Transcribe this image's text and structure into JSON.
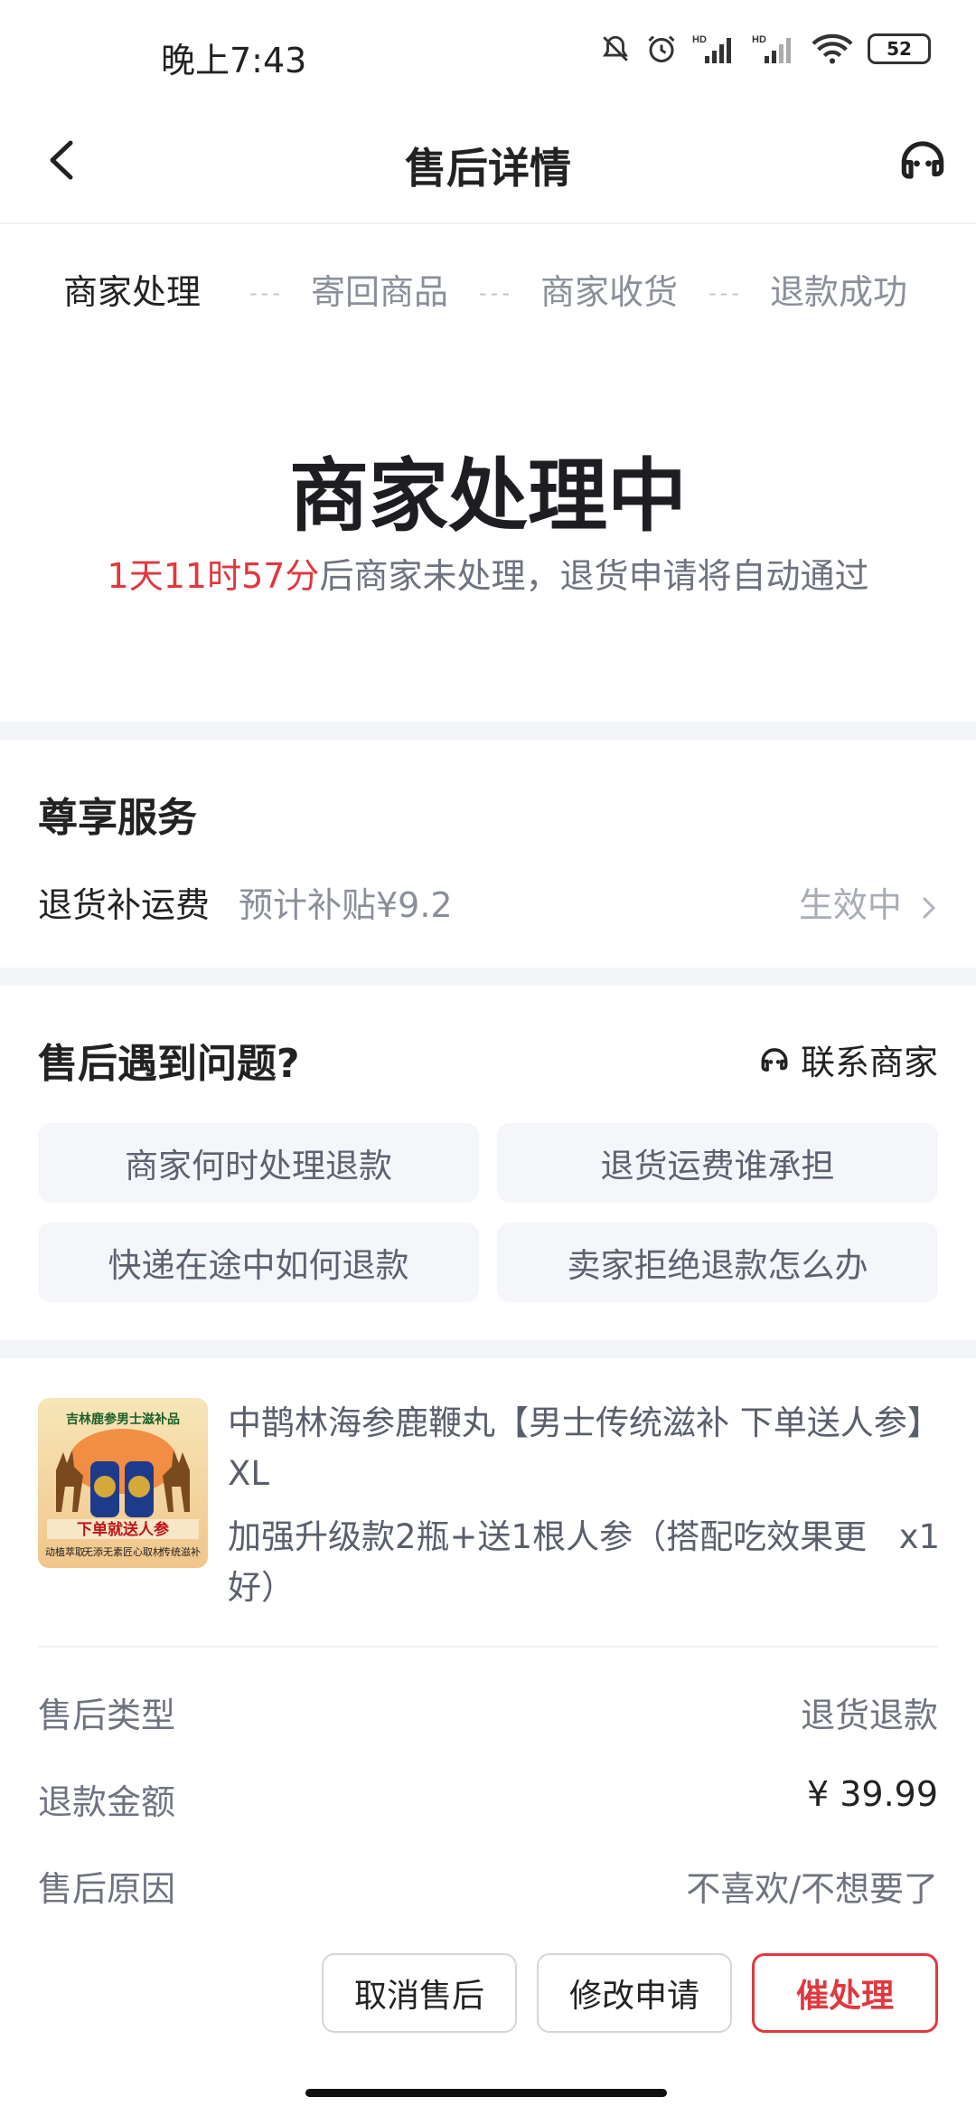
{
  "status_bar": {
    "time": "晚上7:43",
    "battery": "52"
  },
  "header": {
    "title": "售后详情"
  },
  "steps": [
    {
      "label": "商家处理",
      "active": true
    },
    {
      "label": "寄回商品",
      "active": false
    },
    {
      "label": "商家收货",
      "active": false
    },
    {
      "label": "退款成功",
      "active": false
    }
  ],
  "status": {
    "title": "商家处理中",
    "countdown": "1天11时57分",
    "countdown_suffix": "后商家未处理，退货申请将自动通过"
  },
  "service": {
    "title": "尊享服务",
    "label": "退货补运费",
    "desc": "预计补贴¥9.2",
    "status": "生效中"
  },
  "problems": {
    "title": "售后遇到问题?",
    "contact_label": "联系商家",
    "faqs": [
      "商家何时处理退款",
      "退货运费谁承担",
      "快递在途中如何退款",
      "卖家拒绝退款怎么办"
    ]
  },
  "product": {
    "name": "中鹊林海参鹿鞭丸【男士传统滋补 下单送人参】XL",
    "spec": "加强升级款2瓶+送1根人参（搭配吃效果更好）",
    "qty": "x1",
    "image_top_text": "吉林鹿参男士滋补品",
    "image_banner_text": "下单就送人参",
    "image_badges": [
      "动植萃取",
      "无添无素",
      "匠心取材",
      "传统滋补"
    ]
  },
  "details": [
    {
      "label": "售后类型",
      "value": "退货退款"
    },
    {
      "label": "退款金额",
      "value": "¥ 39.99"
    },
    {
      "label": "售后原因",
      "value": "不喜欢/不想要了"
    }
  ],
  "actions": {
    "cancel": "取消售后",
    "modify": "修改申请",
    "urge": "催处理"
  },
  "colors": {
    "accent_red": "#e0383e",
    "muted_text": "#6f7380",
    "band_bg": "#f4f5f8"
  }
}
